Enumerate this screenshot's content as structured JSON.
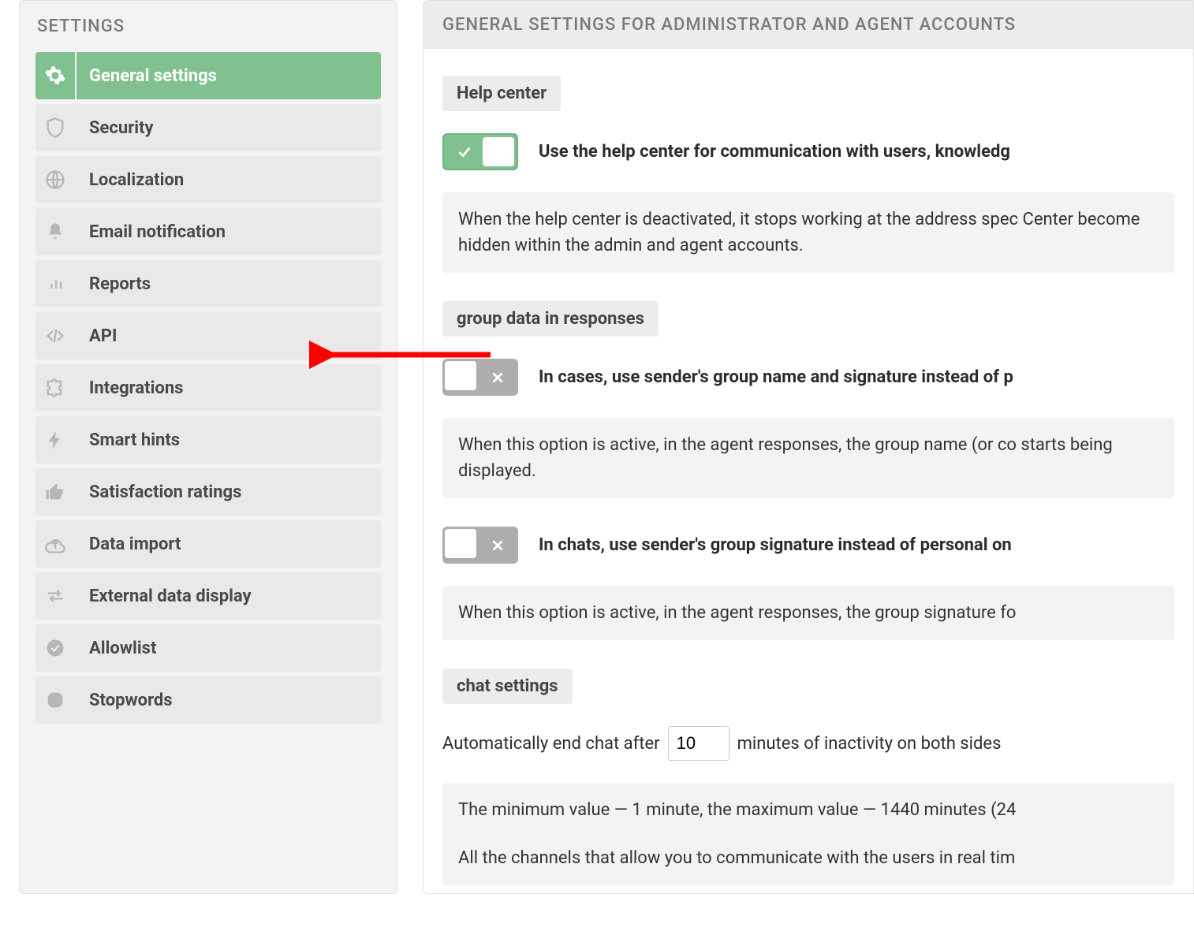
{
  "sidebar": {
    "title": "SETTINGS",
    "items": [
      {
        "label": "General settings"
      },
      {
        "label": "Security"
      },
      {
        "label": "Localization"
      },
      {
        "label": "Email notification"
      },
      {
        "label": "Reports"
      },
      {
        "label": "API"
      },
      {
        "label": "Integrations"
      },
      {
        "label": "Smart hints"
      },
      {
        "label": "Satisfaction ratings"
      },
      {
        "label": "Data import"
      },
      {
        "label": "External data display"
      },
      {
        "label": "Allowlist"
      },
      {
        "label": "Stopwords"
      }
    ]
  },
  "main": {
    "header": "GENERAL SETTINGS FOR ADMINISTRATOR AND AGENT ACCOUNTS",
    "helpCenter": {
      "tag": "Help center",
      "toggleLabel": "Use the help center for communication with users, knowledg",
      "info": "When the help center is deactivated, it stops working at the address spec\nCenter become hidden within the admin and agent accounts."
    },
    "groupData": {
      "tag": "group data in responses",
      "t1Label": "In cases, use sender's group name and signature instead of p",
      "t1Info": "When this option is active, in the agent responses, the group name (or co\nstarts being displayed.",
      "t2Label": "In chats, use sender's group signature instead of personal on",
      "t2Info": "When this option is active, in the agent responses, the group signature fo"
    },
    "chatSettings": {
      "tag": "chat settings",
      "pre": "Automatically end chat after",
      "value": "10",
      "post": "minutes of inactivity on both sides",
      "info1": "The minimum value — 1 minute, the maximum value — 1440 minutes (24",
      "info2": "All the channels that allow you to communicate with the users in real tim"
    }
  }
}
